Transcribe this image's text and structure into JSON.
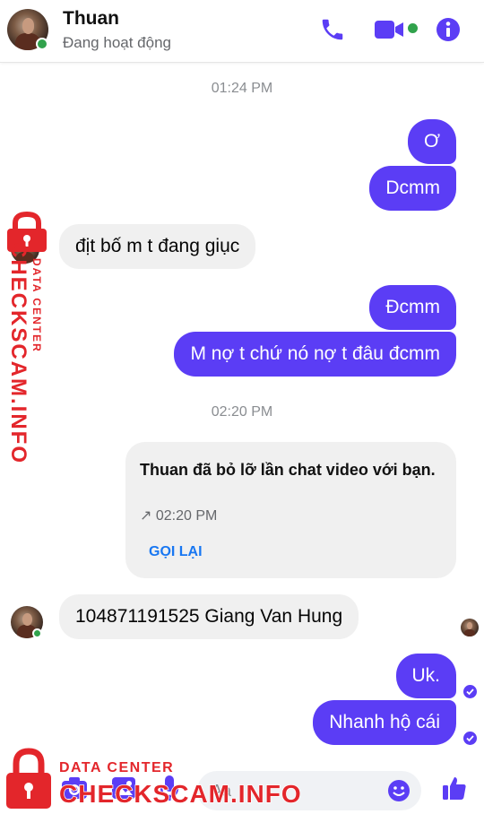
{
  "header": {
    "name": "Thuan",
    "status": "Đang hoạt động",
    "icons": [
      "phone-icon",
      "video-camera-icon",
      "info-icon"
    ],
    "accent_color": "#5b3df5"
  },
  "messages": {
    "time_1": "01:24 PM",
    "out_1": "Ơ",
    "out_2": "Dcmm",
    "in_1": "địt bố m t đang giục",
    "out_3": "Đcmm",
    "out_4": "M nợ t chứ nó nợ t đâu đcmm",
    "time_2": "02:20 PM",
    "in_2": "104871191525 Giang Van Hung",
    "out_5": "Uk.",
    "out_6": "Nhanh hộ cái"
  },
  "call_card": {
    "title": "Thuan đã bỏ lỡ lần chat video với bạn.",
    "time": "↗ 02:20 PM",
    "callback_label": "GỌI LẠI"
  },
  "composer": {
    "placeholder": "Aa",
    "icons": [
      "grid-icon",
      "camera-icon",
      "gallery-icon",
      "microphone-icon",
      "emoji-icon",
      "like-icon"
    ]
  },
  "watermark": {
    "vertical_small": "DATA CENTER",
    "vertical_big": "CHECKSCAM.INFO",
    "bottom_small": "DATA CENTER",
    "bottom_big": "CHECKSCAM.INFO",
    "color": "#e3262b"
  }
}
